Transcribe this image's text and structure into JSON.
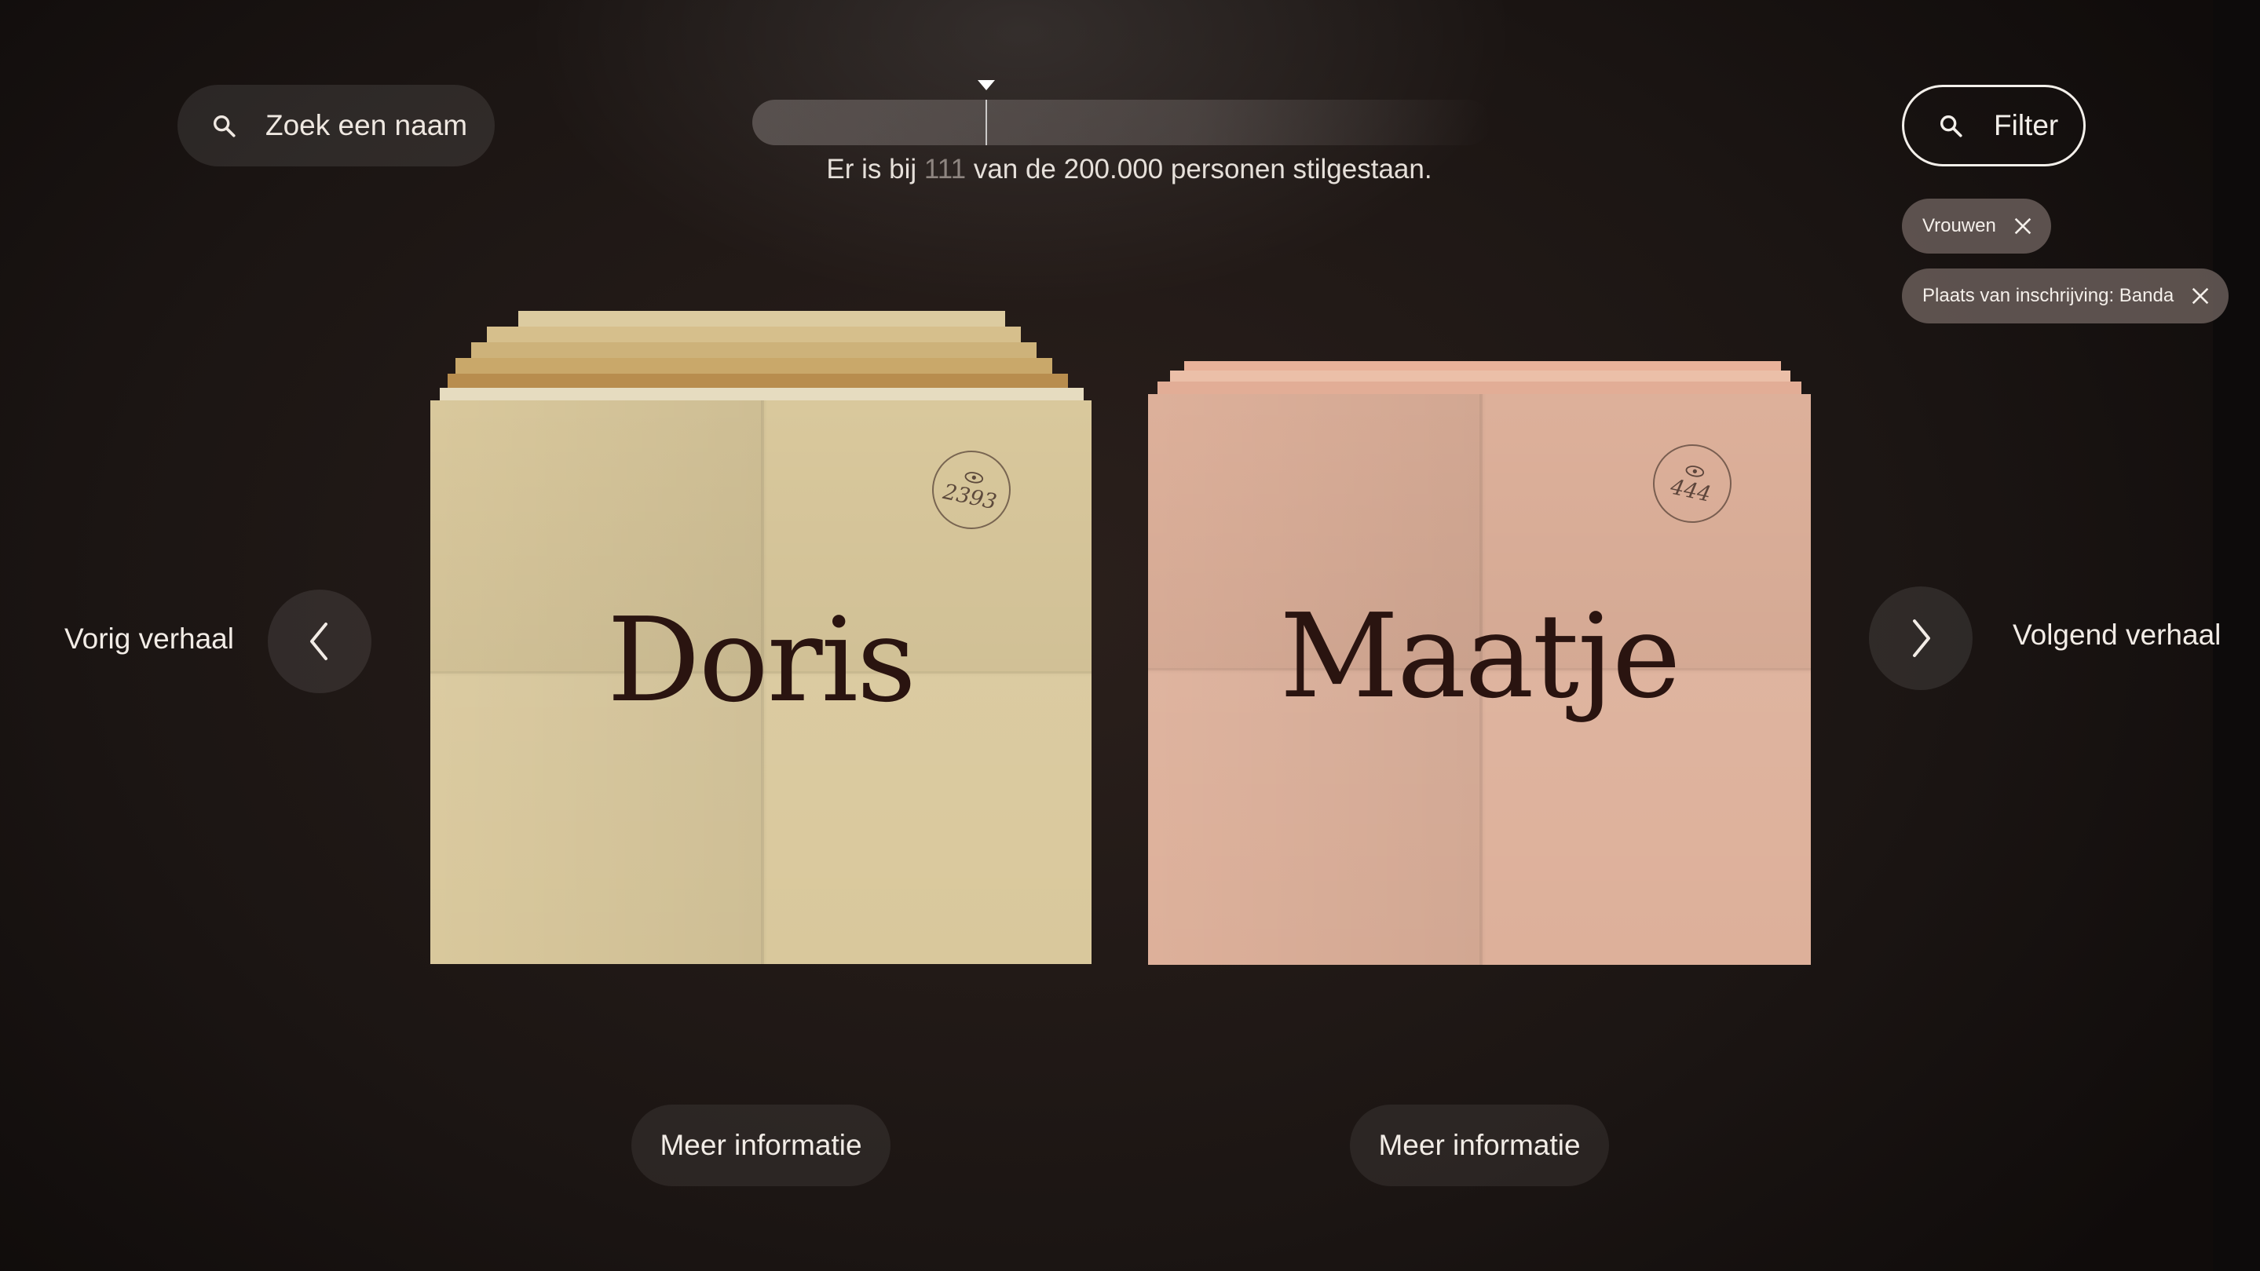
{
  "search": {
    "label": "Zoek een naam"
  },
  "progress": {
    "text_before": "Er is bij",
    "count": "111",
    "text_after": "van de 200.000 personen stilgestaan.",
    "fraction": 0.000555
  },
  "filter": {
    "label": "Filter",
    "chips": [
      {
        "label": "Vrouwen"
      },
      {
        "label": "Plaats van inschrijving: Banda"
      }
    ]
  },
  "navigation": {
    "prev_label": "Vorig verhaal",
    "next_label": "Volgend verhaal"
  },
  "cards": [
    {
      "name": "Doris",
      "views": "2393",
      "more_label": "Meer informatie",
      "color": "#d9c89c"
    },
    {
      "name": "Maatje",
      "views": "444",
      "more_label": "Meer informatie",
      "color": "#ddb09a"
    }
  ],
  "colors": {
    "background": "#1b1513",
    "text": "#f2ece6",
    "card_name": "#2a1410"
  }
}
